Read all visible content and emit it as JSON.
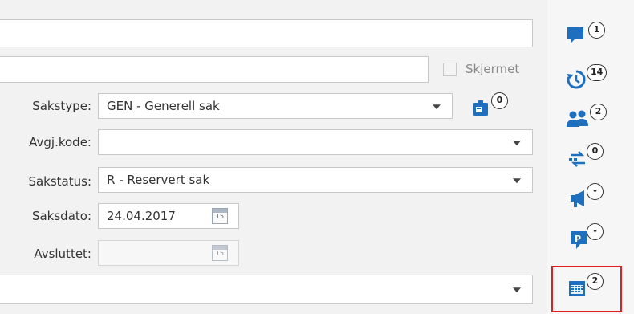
{
  "form": {
    "checkbox_label": "Skjermet",
    "sakstype": {
      "label": "Sakstype:",
      "value": "GEN - Generell sak"
    },
    "avgj_kode": {
      "label": "Avgj.kode:",
      "value": ""
    },
    "sakstatus": {
      "label": "Sakstatus:",
      "value": "R - Reservert sak"
    },
    "saksdato": {
      "label": "Saksdato:",
      "value": "24.04.2017"
    },
    "avsluttet": {
      "label": "Avsluttet:",
      "value": ""
    },
    "calendar_day": "15",
    "document_badge": "0"
  },
  "side_panel": {
    "items": [
      {
        "icon": "comment-icon",
        "count": "1"
      },
      {
        "icon": "history-icon",
        "count": "14"
      },
      {
        "icon": "users-icon",
        "count": "2"
      },
      {
        "icon": "transfer-icon",
        "count": "0"
      },
      {
        "icon": "megaphone-icon",
        "count": "-"
      },
      {
        "icon": "parking-icon",
        "count": "-"
      },
      {
        "icon": "calendar-icon",
        "count": "2"
      }
    ]
  },
  "colors": {
    "icon_blue": "#1f6fbf",
    "highlight_red": "#e02020"
  }
}
